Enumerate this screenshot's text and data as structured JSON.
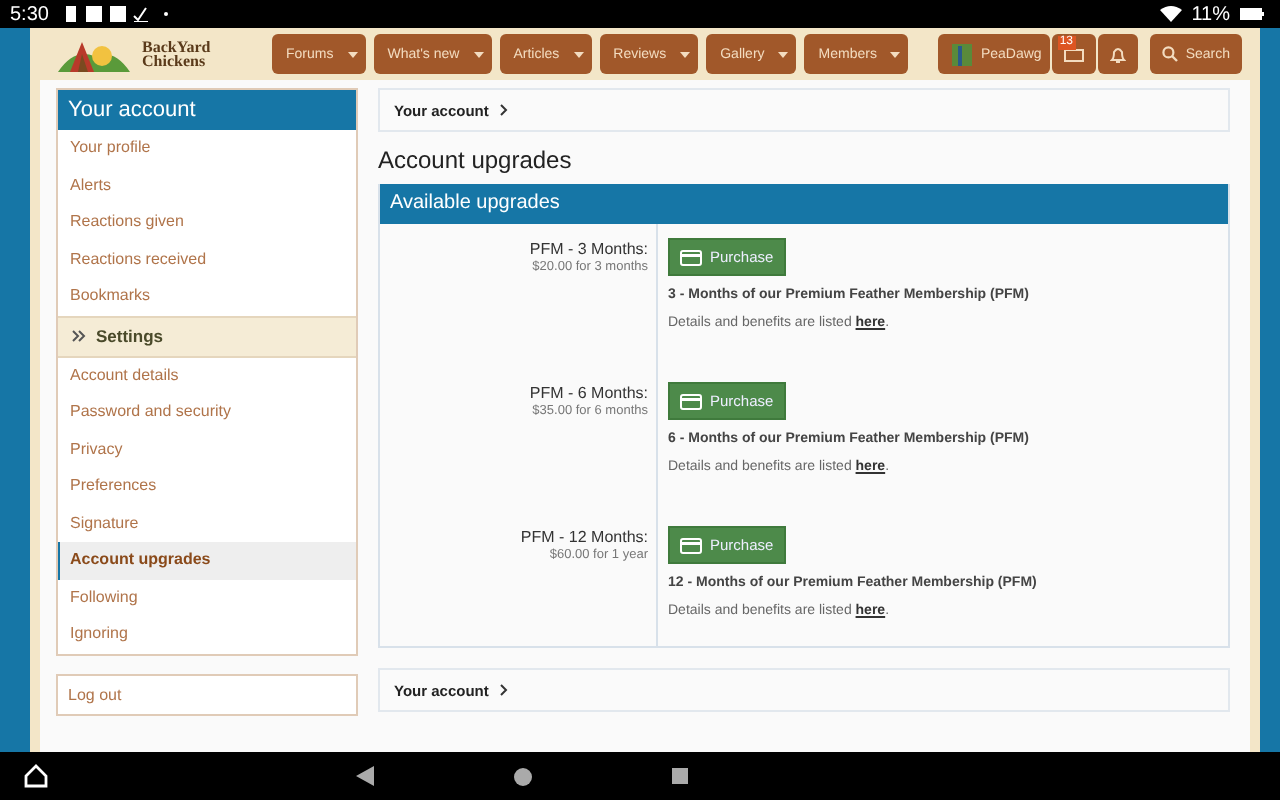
{
  "status_bar": {
    "time": "5:30",
    "battery": "11%"
  },
  "header": {
    "logo": [
      "BackYard",
      "Chickens"
    ],
    "nav": [
      {
        "label": "Forums"
      },
      {
        "label": "What's new"
      },
      {
        "label": "Articles"
      },
      {
        "label": "Reviews"
      },
      {
        "label": "Gallery"
      },
      {
        "label": "Members"
      }
    ],
    "user": "PeaDawg",
    "inbox_count": "13",
    "search": "Search"
  },
  "sidebar": {
    "title": "Your account",
    "items": [
      {
        "kind": "link",
        "label": "Your profile",
        "selected": false
      },
      {
        "kind": "link",
        "label": "Alerts",
        "selected": false
      },
      {
        "kind": "link",
        "label": "Reactions given",
        "selected": false
      },
      {
        "kind": "link",
        "label": "Reactions received",
        "selected": false
      },
      {
        "kind": "link",
        "label": "Bookmarks",
        "selected": false
      },
      {
        "kind": "section",
        "label": "Settings",
        "selected": false
      },
      {
        "kind": "link",
        "label": "Account details",
        "selected": false
      },
      {
        "kind": "link",
        "label": "Password and security",
        "selected": false
      },
      {
        "kind": "link",
        "label": "Privacy",
        "selected": false
      },
      {
        "kind": "link",
        "label": "Preferences",
        "selected": false
      },
      {
        "kind": "link",
        "label": "Signature",
        "selected": false
      },
      {
        "kind": "link",
        "label": "Account upgrades",
        "selected": true
      },
      {
        "kind": "link",
        "label": "Following",
        "selected": false
      },
      {
        "kind": "link",
        "label": "Ignoring",
        "selected": false
      }
    ],
    "logout": "Log out"
  },
  "breadcrumb_top": "Your account",
  "page_title": "Account upgrades",
  "upgrades": {
    "title": "Available upgrades",
    "items": [
      {
        "name": "PFM - 3 Months:",
        "price": "$20.00 for 3 months",
        "button": "Purchase",
        "description": "3 - Months of our Premium Feather Membership (PFM)",
        "details": "Details and benefits are listed",
        "link": "here",
        "after": "."
      },
      {
        "name": "PFM - 6 Months:",
        "price": "$35.00 for 6 months",
        "button": "Purchase",
        "description": "6 - Months of our Premium Feather Membership (PFM)",
        "details": "Details and benefits are listed",
        "link": "here",
        "after": "."
      },
      {
        "name": "PFM - 12 Months:",
        "price": "$60.00 for 1 year",
        "button": "Purchase",
        "description": "12 - Months of our Premium Feather Membership (PFM)",
        "details": "Details and benefits are listed",
        "link": "here",
        "after": "."
      }
    ]
  },
  "breadcrumb_bottom": "Your account"
}
